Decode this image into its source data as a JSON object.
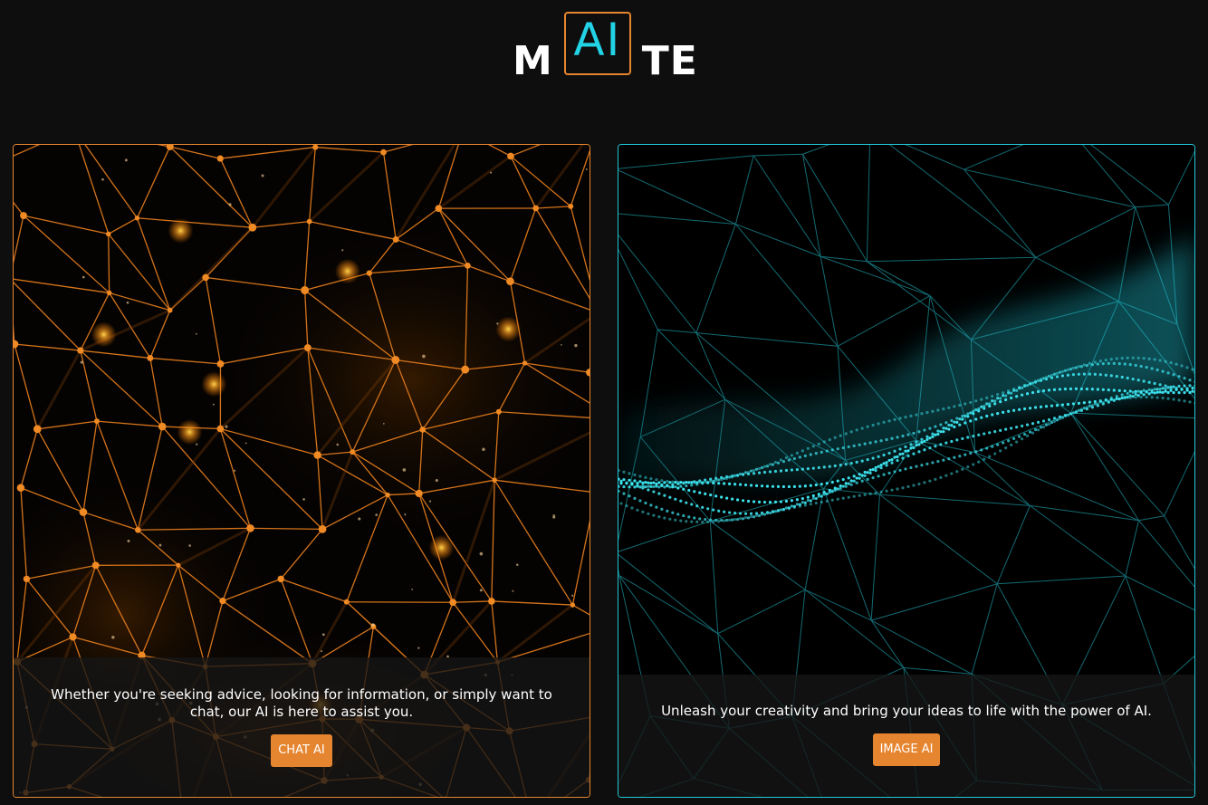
{
  "header": {
    "logo_left": "M",
    "logo_box": "AI",
    "logo_right": "TE"
  },
  "cards": [
    {
      "description": "Whether you're seeking advice, looking for information, or simply want to chat, our AI is here to assist you.",
      "button_label": "CHAT AI",
      "accent": "#e6852f"
    },
    {
      "description": "Unleash your creativity and bring your ideas to life with the power of AI.",
      "button_label": "IMAGE AI",
      "accent": "#22c7d6"
    }
  ],
  "colors": {
    "background": "#0e0e0e",
    "orange": "#e6852f",
    "cyan": "#22d3e6"
  }
}
